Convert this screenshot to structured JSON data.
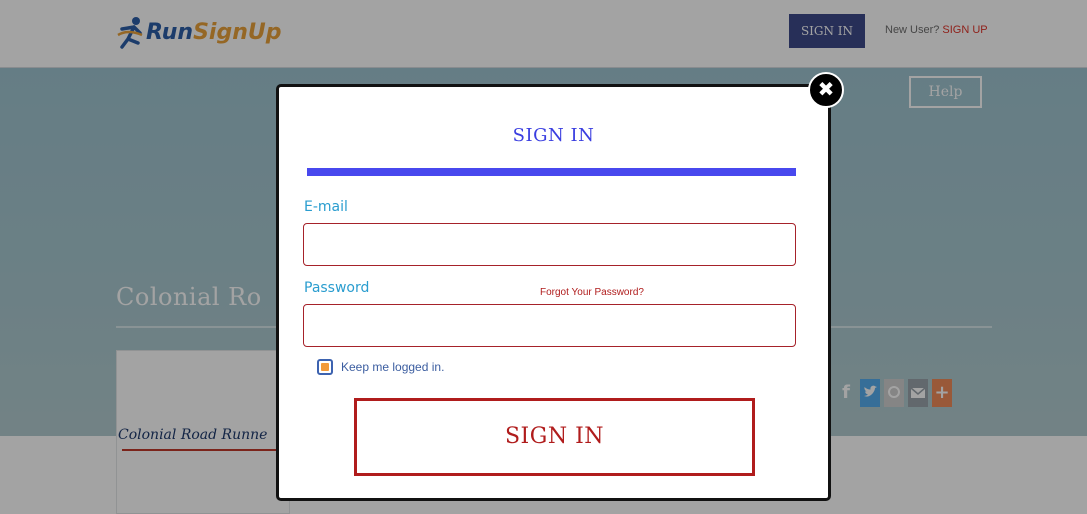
{
  "header": {
    "logo_run": "Run",
    "logo_signup": "SignUp",
    "signin_label": "SIGN IN",
    "new_user_label": "New User?",
    "signup_link": "SIGN UP"
  },
  "hero": {
    "help_label": "Help",
    "race_title": "Colonial Ro",
    "race_logo_text": "Colonial Road Runne"
  },
  "social": {
    "icons": [
      "facebook-icon",
      "twitter-icon",
      "pinterest-icon",
      "email-icon",
      "plus-icon"
    ]
  },
  "modal": {
    "title": "SIGN IN",
    "email_label": "E-mail",
    "email_value": "",
    "password_label": "Password",
    "password_value": "",
    "forgot_link": "Forgot Your Password?",
    "keep_logged_in_label": "Keep me logged in.",
    "keep_logged_in_checked": true,
    "submit_label": "SIGN IN",
    "close_glyph": "✖"
  },
  "colors": {
    "accent_blue": "#4848ee",
    "accent_red": "#b01c1c",
    "label_blue": "#2a9dcf",
    "checkbox_orange": "#f29a3a"
  }
}
